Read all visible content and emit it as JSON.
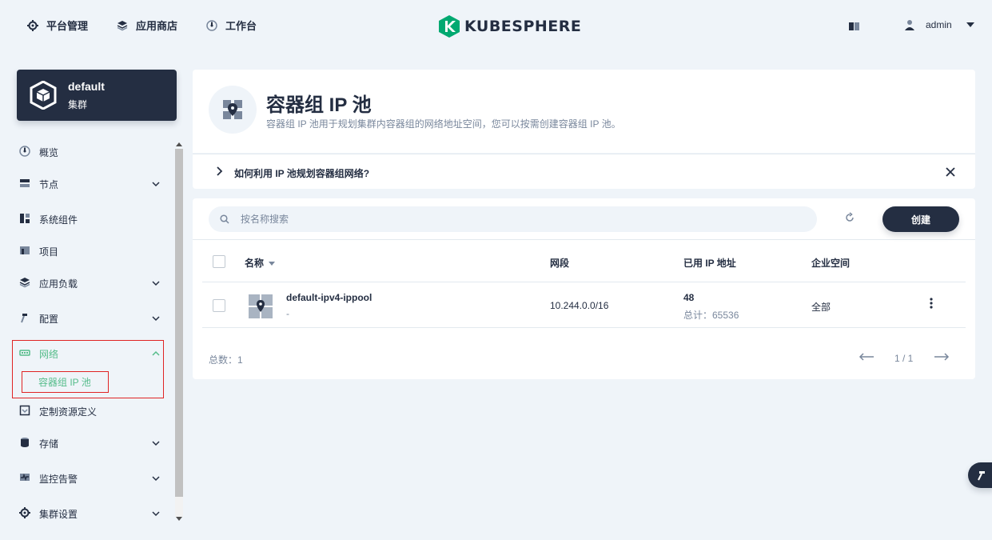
{
  "topnav": {
    "platform": "平台管理",
    "appstore": "应用商店",
    "workbench": "工作台",
    "logo_text": "KUBESPHERE",
    "username": "admin"
  },
  "cluster": {
    "name": "default",
    "subtitle": "集群"
  },
  "sidebar": {
    "items": [
      {
        "label": "概览",
        "icon": "dashboard-icon"
      },
      {
        "label": "节点",
        "icon": "nodes-icon"
      },
      {
        "label": "系统组件",
        "icon": "components-icon"
      },
      {
        "label": "项目",
        "icon": "project-icon"
      },
      {
        "label": "应用负载",
        "icon": "appworkload-icon"
      },
      {
        "label": "配置",
        "icon": "hammer-icon"
      },
      {
        "label": "网络",
        "icon": "network-icon"
      },
      {
        "label": "定制资源定义",
        "icon": "crd-icon"
      },
      {
        "label": "存储",
        "icon": "storage-icon"
      },
      {
        "label": "监控告警",
        "icon": "monitor-icon"
      },
      {
        "label": "集群设置",
        "icon": "gear-icon"
      }
    ],
    "network_sub": "容器组 IP 池"
  },
  "header": {
    "title": "容器组 IP 池",
    "description": "容器组 IP 池用于规划集群内容器组的网络地址空间，您可以按需创建容器组 IP 池。"
  },
  "help": {
    "text": "如何利用 IP 池规划容器组网络?"
  },
  "toolbar": {
    "search_placeholder": "按名称搜索",
    "create_label": "创建"
  },
  "table": {
    "columns": {
      "name": "名称",
      "cidr": "网段",
      "used": "已用 IP 地址",
      "workspace": "企业空间"
    },
    "rows": [
      {
        "name": "default-ipv4-ippool",
        "desc": "-",
        "cidr": "10.244.0.0/16",
        "used": "48",
        "total": "总计：65536",
        "workspace": "全部"
      }
    ]
  },
  "pagination": {
    "total": "总数：1",
    "page": "1 / 1"
  },
  "colors": {
    "accent": "#55bc8a",
    "dark": "#242e42",
    "muted": "#79879c",
    "highlight_border": "#e02424"
  }
}
